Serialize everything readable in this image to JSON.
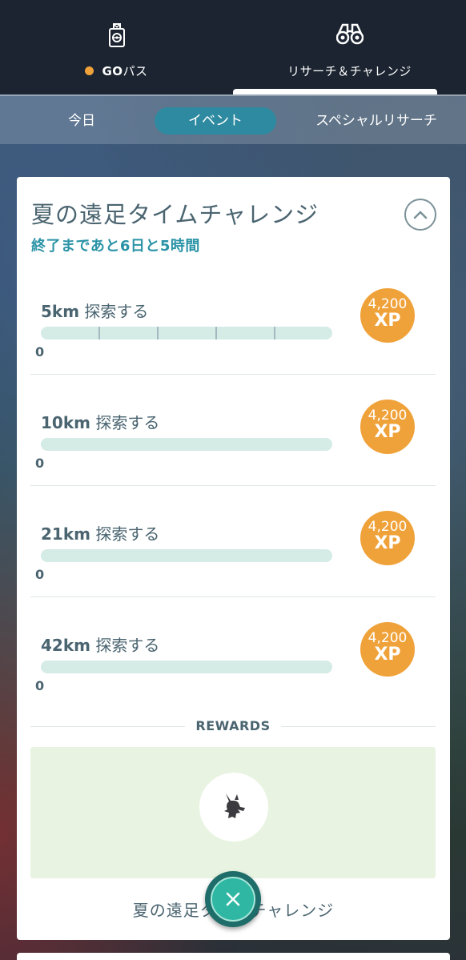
{
  "header": {
    "tabs": [
      {
        "label": "GOパス",
        "label_bold": "GO",
        "label_rest": "パス",
        "icon": "pass-icon",
        "dot_color": "#f0a23a"
      },
      {
        "label": "リサーチ＆チャレンジ",
        "icon": "binoculars-icon",
        "active": true
      }
    ]
  },
  "subtabs": [
    {
      "label": "今日",
      "active": false
    },
    {
      "label": "イベント",
      "active": true
    },
    {
      "label": "スペシャルリサーチ",
      "active": false
    }
  ],
  "challenge": {
    "title": "夏の遠足タイムチャレンジ",
    "time_remaining": "終了まであと6日と5時間",
    "collapse_icon": "chevron-up-icon",
    "tasks": [
      {
        "distance": "5km",
        "action": "探索する",
        "progress": "0",
        "progress_fraction": 0,
        "xp_amount": "4,200",
        "xp_unit": "XP"
      },
      {
        "distance": "10km",
        "action": "探索する",
        "progress": "0",
        "progress_fraction": 0,
        "xp_amount": "4,200",
        "xp_unit": "XP"
      },
      {
        "distance": "21km",
        "action": "探索する",
        "progress": "0",
        "progress_fraction": 0,
        "xp_amount": "4,200",
        "xp_unit": "XP"
      },
      {
        "distance": "42km",
        "action": "探索する",
        "progress": "0",
        "progress_fraction": 0,
        "xp_amount": "4,200",
        "xp_unit": "XP"
      }
    ],
    "rewards_label": "REWARDS",
    "reward_icon": "pikachu-silhouette-icon",
    "footer_title": "夏の遠足タイムチャレンジ"
  },
  "close_icon": "close-icon",
  "colors": {
    "accent_teal": "#2a93a6",
    "xp_orange": "#f0a23a",
    "close_button": "#2fb7a4"
  }
}
